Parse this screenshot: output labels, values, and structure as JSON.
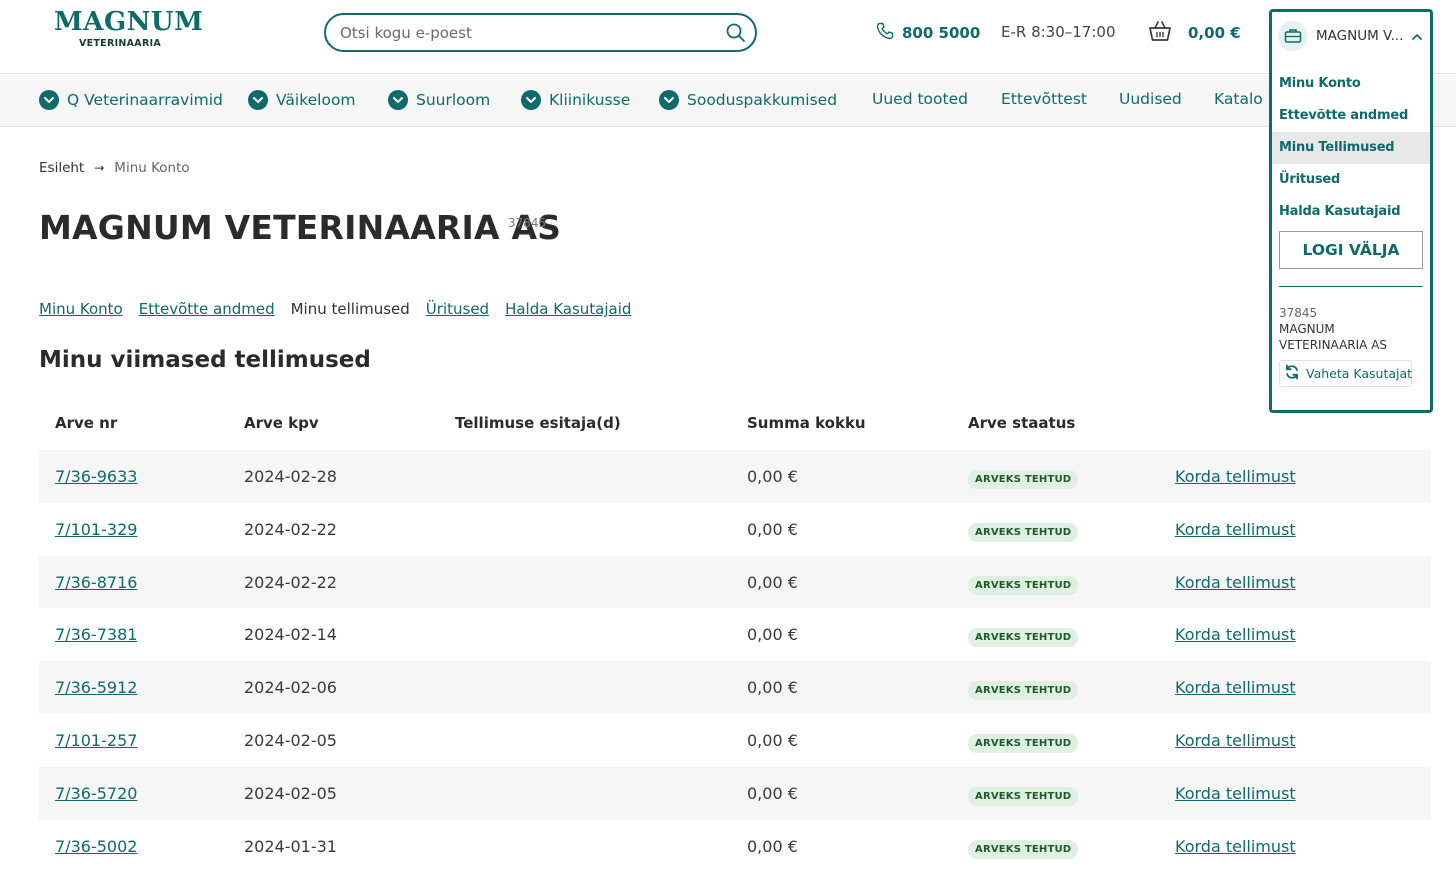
{
  "logo": {
    "main": "MAGNUM",
    "sub": "VETERINAARIA"
  },
  "search": {
    "placeholder": "Otsi kogu e-poest"
  },
  "header": {
    "phone": "800 5000",
    "hours": "E-R 8:30–17:00",
    "cart_total": "0,00 €",
    "account_short": "MAGNUM V..."
  },
  "nav": [
    {
      "label": "Q Veterinaarravimid",
      "chevron": true
    },
    {
      "label": "Väikeloom",
      "chevron": true
    },
    {
      "label": "Suurloom",
      "chevron": true
    },
    {
      "label": "Kliinikusse",
      "chevron": true
    },
    {
      "label": "Sooduspakkumised",
      "chevron": true
    },
    {
      "label": "Uued tooted",
      "chevron": false
    },
    {
      "label": "Ettevõttest",
      "chevron": false
    },
    {
      "label": "Uudised",
      "chevron": false
    },
    {
      "label": "Katalo",
      "chevron": false
    }
  ],
  "breadcrumb": {
    "home": "Esileht",
    "separator": "→",
    "current": "Minu Konto"
  },
  "page": {
    "title": "MAGNUM VETERINAARIA AS",
    "title_num": "37845",
    "section_title": "Minu viimased tellimused"
  },
  "subnav": [
    {
      "label": "Minu Konto",
      "link": true
    },
    {
      "label": "Ettevõtte andmed",
      "link": true
    },
    {
      "label": "Minu tellimused",
      "link": false
    },
    {
      "label": "Üritused",
      "link": true
    },
    {
      "label": "Halda Kasutajaid",
      "link": true
    }
  ],
  "table": {
    "headers": [
      "Arve nr",
      "Arve kpv",
      "Tellimuse esitaja(d)",
      "Summa kokku",
      "Arve staatus"
    ],
    "rows": [
      {
        "nr": "7/36-9633",
        "date": "2024-02-28",
        "by": "",
        "sum": "0,00 €",
        "status": "ARVEKS TEHTUD",
        "action": "Korda tellimust"
      },
      {
        "nr": "7/101-329",
        "date": "2024-02-22",
        "by": "",
        "sum": "0,00 €",
        "status": "ARVEKS TEHTUD",
        "action": "Korda tellimust"
      },
      {
        "nr": "7/36-8716",
        "date": "2024-02-22",
        "by": "",
        "sum": "0,00 €",
        "status": "ARVEKS TEHTUD",
        "action": "Korda tellimust"
      },
      {
        "nr": "7/36-7381",
        "date": "2024-02-14",
        "by": "",
        "sum": "0,00 €",
        "status": "ARVEKS TEHTUD",
        "action": "Korda tellimust"
      },
      {
        "nr": "7/36-5912",
        "date": "2024-02-06",
        "by": "",
        "sum": "0,00 €",
        "status": "ARVEKS TEHTUD",
        "action": "Korda tellimust"
      },
      {
        "nr": "7/101-257",
        "date": "2024-02-05",
        "by": "",
        "sum": "0,00 €",
        "status": "ARVEKS TEHTUD",
        "action": "Korda tellimust"
      },
      {
        "nr": "7/36-5720",
        "date": "2024-02-05",
        "by": "",
        "sum": "0,00 €",
        "status": "ARVEKS TEHTUD",
        "action": "Korda tellimust"
      },
      {
        "nr": "7/36-5002",
        "date": "2024-01-31",
        "by": "",
        "sum": "0,00 €",
        "status": "ARVEKS TEHTUD",
        "action": "Korda tellimust"
      }
    ]
  },
  "dropdown": {
    "menu": [
      "Minu Konto",
      "Ettevõtte andmed",
      "Minu Tellimused",
      "Üritused",
      "Halda Kasutajaid"
    ],
    "active_index": 2,
    "logout": "LOGI VÄLJA",
    "customer_num": "37845",
    "customer_name": "MAGNUM VETERINAARIA AS",
    "switch_user": "Vaheta Kasutajat"
  },
  "colors": {
    "brand": "#0e6a6b",
    "badge_bg": "#dff0e2",
    "row_alt": "#f6f6f6"
  }
}
